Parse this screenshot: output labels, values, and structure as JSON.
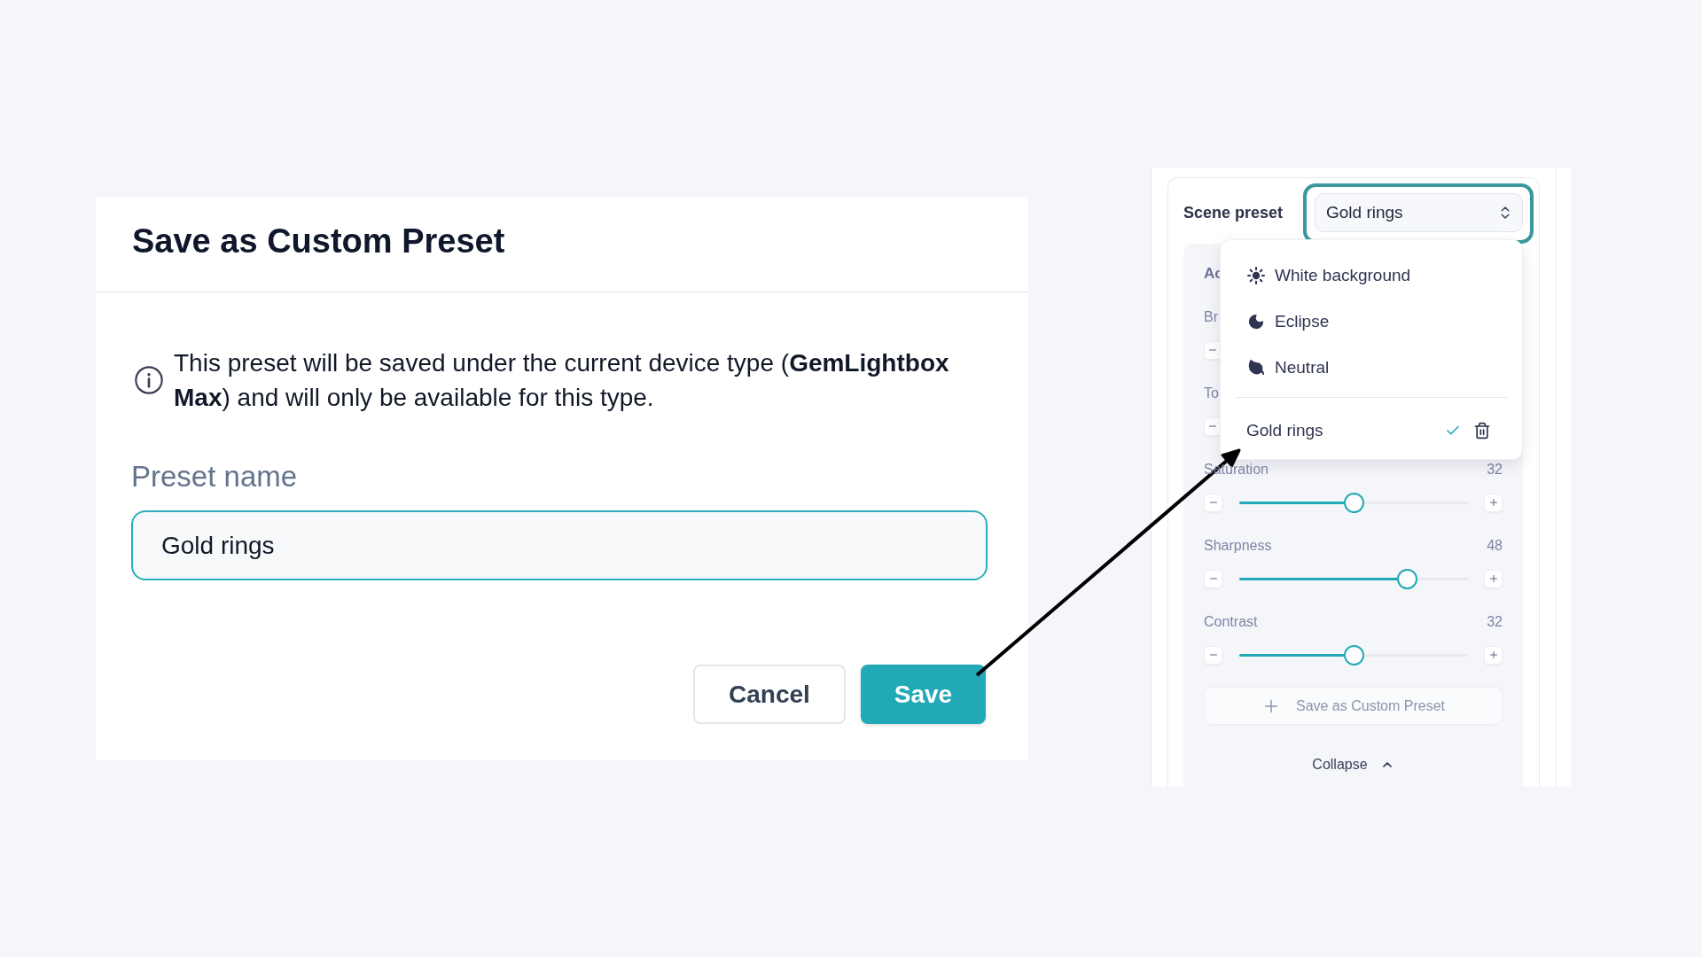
{
  "dialog": {
    "title": "Save as Custom Preset",
    "notice": "This preset will be saved under the current device type (**GemLightbox Max**) and will only be available for this type.",
    "field": {
      "label": "Preset name",
      "value": "Gold rings"
    },
    "buttons": [
      {
        "label": "Cancel",
        "kind": "secondary"
      },
      {
        "label": "Save",
        "kind": "primary"
      }
    ]
  },
  "panel": {
    "scene_preset": {
      "label": "Scene preset",
      "value": "Gold rings"
    },
    "adjustments": {
      "heading": "Ac",
      "sliders": [
        {
          "kind": "partial",
          "label": "Br"
        },
        {
          "kind": "partial",
          "label": "To"
        },
        {
          "kind": "full",
          "label": "Saturation",
          "value": "32",
          "level": 0.5
        },
        {
          "kind": "full",
          "label": "Sharpness",
          "value": "48",
          "level": 0.73
        },
        {
          "kind": "full",
          "label": "Contrast",
          "value": "32",
          "level": 0.5
        }
      ]
    },
    "save_button": "Save as Custom Preset",
    "collapse": "Collapse",
    "preset_menu": {
      "builtin": [
        {
          "label": "White background",
          "selected": false
        },
        {
          "label": "Eclipse",
          "selected": false
        },
        {
          "label": "Neutral",
          "selected": false
        }
      ],
      "custom": [
        {
          "label": "Gold rings",
          "selected": true
        }
      ]
    }
  }
}
